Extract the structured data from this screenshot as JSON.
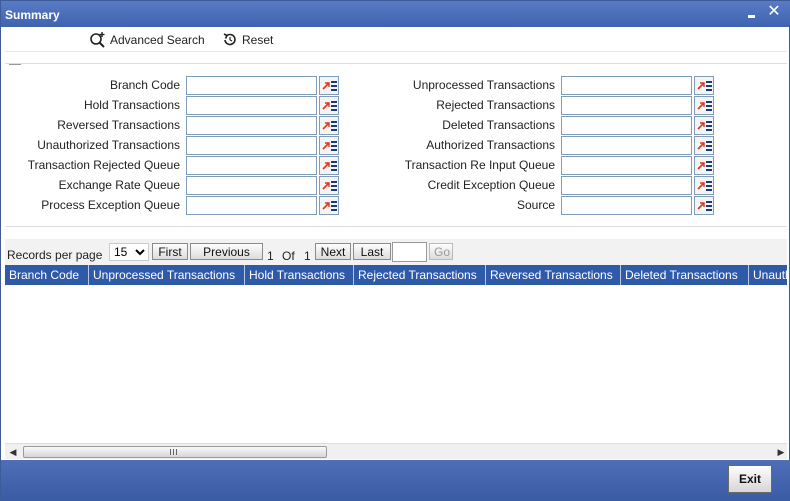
{
  "window": {
    "title": "Summary"
  },
  "toolbar": {
    "advanced_search_label": "Advanced Search",
    "reset_label": "Reset"
  },
  "criteria": {
    "left": [
      {
        "label": "Branch Code",
        "value": ""
      },
      {
        "label": "Hold Transactions",
        "value": ""
      },
      {
        "label": "Reversed Transactions",
        "value": ""
      },
      {
        "label": "Unauthorized Transactions",
        "value": ""
      },
      {
        "label": "Transaction Rejected Queue",
        "value": ""
      },
      {
        "label": "Exchange Rate Queue",
        "value": ""
      },
      {
        "label": "Process Exception Queue",
        "value": ""
      }
    ],
    "right": [
      {
        "label": "Unprocessed Transactions",
        "value": ""
      },
      {
        "label": "Rejected Transactions",
        "value": ""
      },
      {
        "label": "Deleted Transactions",
        "value": ""
      },
      {
        "label": "Authorized Transactions",
        "value": ""
      },
      {
        "label": "Transaction Re Input Queue",
        "value": ""
      },
      {
        "label": "Credit Exception Queue",
        "value": ""
      },
      {
        "label": "Source",
        "value": ""
      }
    ]
  },
  "pager": {
    "records_per_page_label": "Records per page",
    "records_per_page_value": "15",
    "first_label": "First",
    "previous_label": "Previous",
    "current_page": "1",
    "of_label": "Of",
    "total_pages": "1",
    "next_label": "Next",
    "last_label": "Last",
    "goto_value": "",
    "go_label": "Go"
  },
  "grid": {
    "columns": [
      "Branch Code",
      "Unprocessed Transactions",
      "Hold Transactions",
      "Rejected Transactions",
      "Reversed Transactions",
      "Deleted Transactions",
      "Unauth"
    ]
  },
  "footer": {
    "exit_label": "Exit"
  },
  "colors": {
    "titlebar": "#3f63b0",
    "grid_header": "#2f5aa8",
    "lov_arrow": "#d9381e",
    "lov_lines": "#1a3a7a"
  }
}
